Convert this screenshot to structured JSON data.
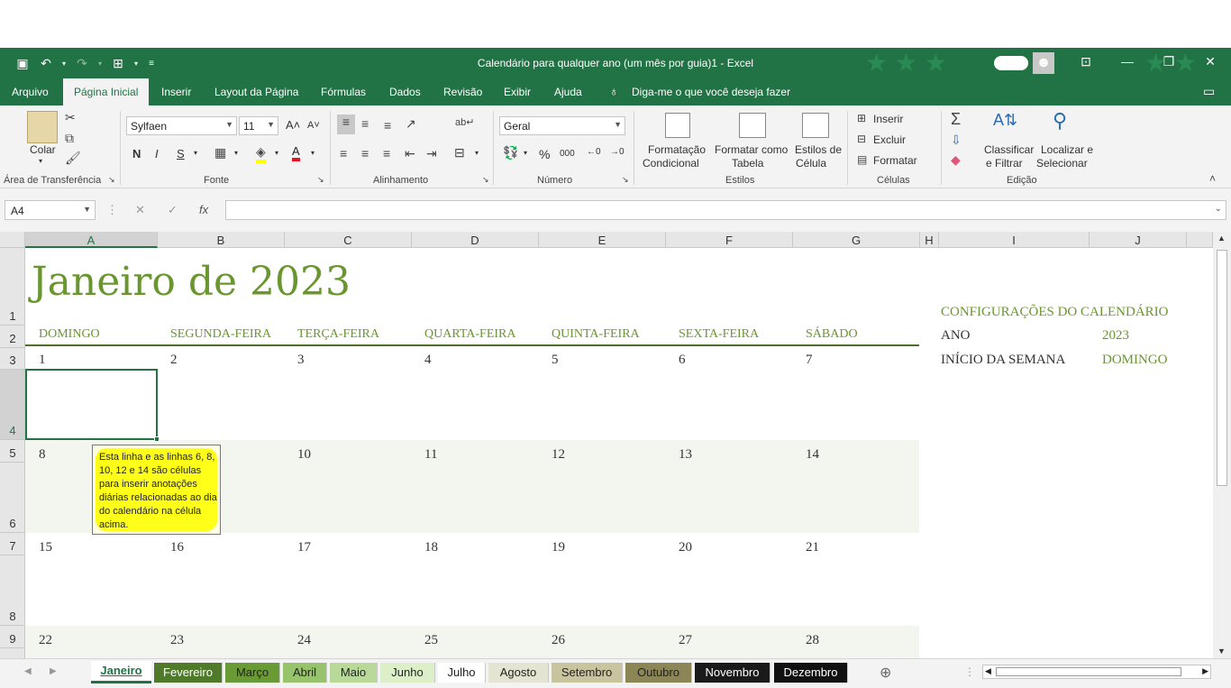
{
  "window": {
    "title": "Calendário para qualquer ano (um mês por guia)1  -  Excel"
  },
  "menu": {
    "items": [
      "Arquivo",
      "Página Inicial",
      "Inserir",
      "Layout da Página",
      "Fórmulas",
      "Dados",
      "Revisão",
      "Exibir",
      "Ajuda"
    ],
    "tell_me": "Diga-me o que você deseja fazer"
  },
  "ribbon": {
    "clipboard": {
      "paste": "Colar",
      "group": "Área de Transferência"
    },
    "font": {
      "name": "Sylfaen",
      "size": "11",
      "group": "Fonte",
      "bold": "N",
      "italic": "I",
      "underline": "S"
    },
    "alignment": {
      "group": "Alinhamento"
    },
    "number": {
      "format": "Geral",
      "group": "Número"
    },
    "styles": {
      "conditional_1": "Formatação",
      "conditional_2": "Condicional",
      "table_1": "Formatar como",
      "table_2": "Tabela",
      "cell_1": "Estilos de",
      "cell_2": "Célula",
      "group": "Estilos"
    },
    "cells": {
      "insert": "Inserir",
      "delete": "Excluir",
      "format": "Formatar",
      "group": "Células"
    },
    "editing": {
      "sort_1": "Classificar",
      "sort_2": "e Filtrar",
      "find_1": "Localizar e",
      "find_2": "Selecionar",
      "group": "Edição"
    }
  },
  "formula_bar": {
    "name_box": "A4",
    "fx": "fx",
    "value": ""
  },
  "sheet": {
    "columns": [
      "A",
      "B",
      "C",
      "D",
      "E",
      "F",
      "G",
      "H",
      "I",
      "J"
    ],
    "rows": [
      "1",
      "2",
      "3",
      "4",
      "5",
      "6",
      "7",
      "8",
      "9"
    ],
    "month_title": "Janeiro de 2023",
    "weekdays": [
      "DOMINGO",
      "SEGUNDA-FEIRA",
      "TERÇA-FEIRA",
      "QUARTA-FEIRA",
      "QUINTA-FEIRA",
      "SEXTA-FEIRA",
      "SÁBADO"
    ],
    "weeks": [
      [
        "1",
        "2",
        "3",
        "4",
        "5",
        "6",
        "7"
      ],
      [
        "8",
        "9",
        "10",
        "11",
        "12",
        "13",
        "14"
      ],
      [
        "15",
        "16",
        "17",
        "18",
        "19",
        "20",
        "21"
      ],
      [
        "22",
        "23",
        "24",
        "25",
        "26",
        "27",
        "28"
      ]
    ],
    "tooltip": "Esta linha e as linhas 6, 8, 10, 12 e 14 são células para inserir anotações diárias relacionadas ao dia do calendário na célula acima.",
    "settings": {
      "title": "CONFIGURAÇÕES DO CALENDÁRIO",
      "year_label": "ANO",
      "year_value": "2023",
      "week_start_label": "INÍCIO DA SEMANA",
      "week_start_value": "DOMINGO"
    },
    "colors": {
      "accent": "#6a962f",
      "excel_green": "#217346"
    }
  },
  "tabs": [
    {
      "label": "Janeiro",
      "bg": "#ffffff",
      "fg": "#217346"
    },
    {
      "label": "Fevereiro",
      "bg": "#4e7a2a",
      "fg": "#ffffff"
    },
    {
      "label": "Março",
      "bg": "#6a9a35",
      "fg": "#222222"
    },
    {
      "label": "Abril",
      "bg": "#96c36b",
      "fg": "#222222"
    },
    {
      "label": "Maio",
      "bg": "#b9d99b",
      "fg": "#222222"
    },
    {
      "label": "Junho",
      "bg": "#dcefc9",
      "fg": "#222222"
    },
    {
      "label": "Julho",
      "bg": "#ffffff",
      "fg": "#222222"
    },
    {
      "label": "Agosto",
      "bg": "#e4e4d2",
      "fg": "#222222"
    },
    {
      "label": "Setembro",
      "bg": "#c9c4a0",
      "fg": "#222222"
    },
    {
      "label": "Outubro",
      "bg": "#8c8556",
      "fg": "#222222"
    },
    {
      "label": "Novembro",
      "bg": "#1a1a1a",
      "fg": "#ffffff"
    },
    {
      "label": "Dezembro",
      "bg": "#111111",
      "fg": "#ffffff"
    }
  ]
}
